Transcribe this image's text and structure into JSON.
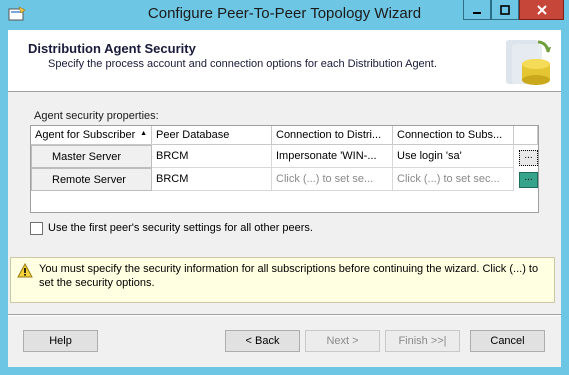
{
  "window": {
    "title": "Configure Peer-To-Peer Topology Wizard",
    "title_color": "#6dc6e3",
    "close_color": "#c7463a"
  },
  "header": {
    "title": "Distribution Agent Security",
    "subtitle": "Specify the process account and connection options for each Distribution Agent.",
    "icon": "database-sync-icon"
  },
  "properties_label": "Agent security properties:",
  "grid": {
    "columns": [
      "Agent for Subscriber",
      "Peer Database",
      "Connection to Distri...",
      "Connection to Subs..."
    ],
    "sort_indicator": "▲",
    "rows": [
      {
        "subscriber": "Master Server",
        "peer_db": "BRCM",
        "conn_distributor": "Impersonate 'WIN-...",
        "conn_subscriber": "Use login 'sa'",
        "button": "..."
      },
      {
        "subscriber": "Remote Server",
        "peer_db": "BRCM",
        "conn_distributor": "Click (...) to set se...",
        "conn_subscriber": "Click (...) to set sec...",
        "button": "..."
      }
    ]
  },
  "checkbox": {
    "label": "Use the first peer's security settings for all other peers.",
    "checked": false
  },
  "warning": {
    "icon": "warning-icon",
    "text": "You must specify the security information for all subscriptions before continuing the wizard. Click (...) to set the security options."
  },
  "buttons": {
    "help": "Help",
    "back": "< Back",
    "next": "Next >",
    "finish": "Finish >>|",
    "cancel": "Cancel"
  }
}
